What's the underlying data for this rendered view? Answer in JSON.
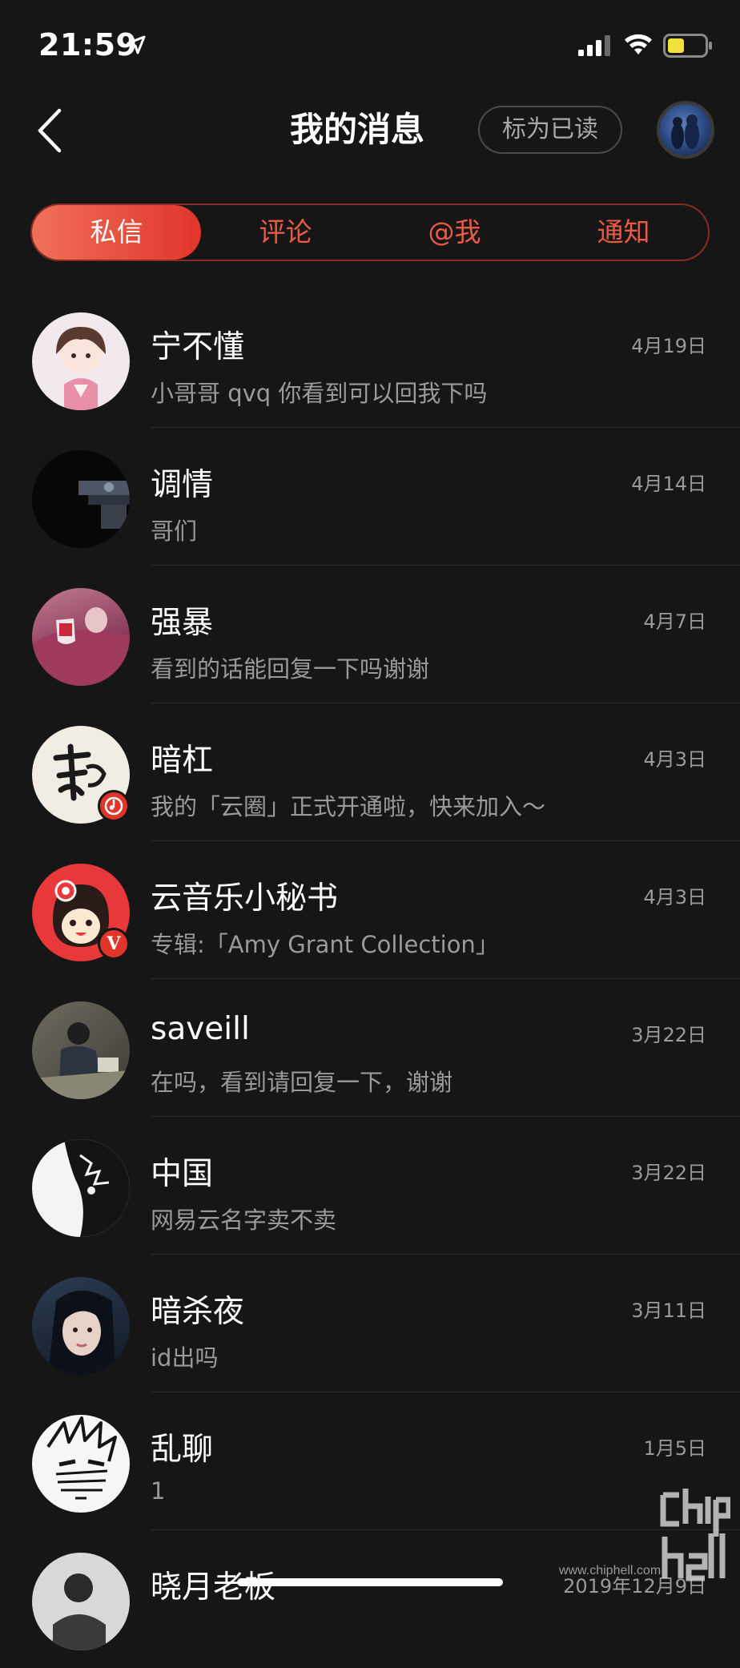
{
  "status_bar": {
    "time": "21:59"
  },
  "header": {
    "title": "我的消息",
    "mark_read_label": "标为已读"
  },
  "tabs": [
    {
      "label": "私信",
      "active": true
    },
    {
      "label": "评论",
      "active": false
    },
    {
      "label": "@我",
      "active": false
    },
    {
      "label": "通知",
      "active": false
    }
  ],
  "messages": [
    {
      "name": "宁不懂",
      "preview": "小哥哥 qvq 你看到可以回我下吗",
      "date": "4月19日"
    },
    {
      "name": "调情",
      "preview": "哥们",
      "date": "4月14日"
    },
    {
      "name": "强暴",
      "preview": "看到的话能回复一下吗谢谢",
      "date": "4月7日"
    },
    {
      "name": "暗杠",
      "preview": "我的「云圈」正式开通啦，快来加入～",
      "date": "4月3日",
      "badge": "music-note-icon"
    },
    {
      "name": "云音乐小秘书",
      "preview": "专辑:「Amy Grant Collection」",
      "date": "4月3日",
      "badge_text": "V"
    },
    {
      "name": "saveill",
      "preview": "在吗，看到请回复一下，谢谢",
      "date": "3月22日"
    },
    {
      "name": "中国",
      "preview": "网易云名字卖不卖",
      "date": "3月22日"
    },
    {
      "name": "暗杀夜",
      "preview": "id出吗",
      "date": "3月11日"
    },
    {
      "name": "乱聊",
      "preview": "1",
      "date": "1月5日"
    },
    {
      "name": "晓月老板",
      "preview": "",
      "date": "2019年12月9日"
    }
  ],
  "watermark": {
    "site": "www.chiphell.com"
  },
  "colors": {
    "background": "#161616",
    "accent": "#e0352a",
    "accent_light": "#f07058",
    "secondary_text": "#9a9a9a"
  }
}
